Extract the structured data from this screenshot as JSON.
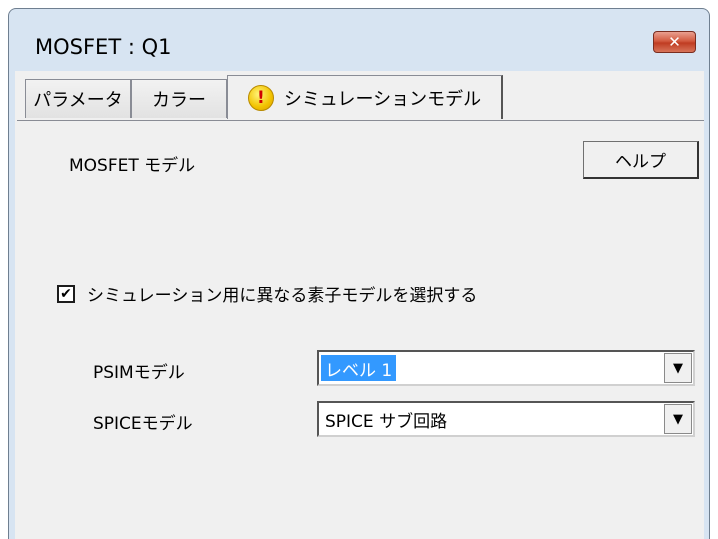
{
  "window": {
    "title": "MOSFET : Q1",
    "close_glyph": "✕"
  },
  "tabs": [
    {
      "label": "パラメータ"
    },
    {
      "label": "カラー"
    },
    {
      "label": "シミュレーションモデル",
      "icon": "warning-icon",
      "icon_glyph": "!"
    }
  ],
  "panel": {
    "heading": "MOSFET モデル",
    "help_label": "ヘルプ",
    "checkbox_label": "シミュレーション用に異なる素子モデルを選択する",
    "checkbox_checked": true,
    "checkbox_glyph": "✔",
    "psim_label": "PSIMモデル",
    "psim_value": "レベル 1",
    "spice_label": "SPICEモデル",
    "spice_value": "SPICE サブ回路",
    "dropdown_glyph": "▼"
  },
  "colors": {
    "selection": "#3399ff",
    "close_button": "#c9452c",
    "warning": "#f2c200"
  }
}
